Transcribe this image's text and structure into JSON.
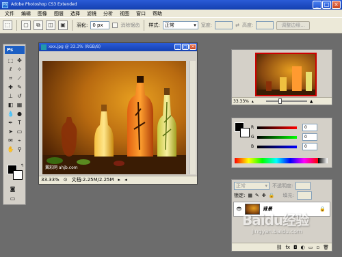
{
  "app": {
    "title": "Adobe Photoshop CS3 Extended"
  },
  "menubar": {
    "items": [
      "文件",
      "编辑",
      "图像",
      "图层",
      "选择",
      "滤镜",
      "分析",
      "视图",
      "窗口",
      "帮助"
    ]
  },
  "options": {
    "feather_label": "羽化:",
    "feather_value": "0 px",
    "antialias_label": "消除锯齿",
    "style_label": "样式:",
    "style_value": "正常",
    "width_label": "宽度:",
    "height_label": "高度:",
    "refine_button": "调整边缘..."
  },
  "toolbox": {
    "logo": "Ps"
  },
  "document": {
    "title": "xxx.jpg @ 33.3% (RGB/8)",
    "zoom": "33.33%",
    "doc_info": "文档:2.25M/2.25M",
    "watermark": "翼彩网 ahjb.com"
  },
  "navigator": {
    "zoom": "33.33%"
  },
  "color": {
    "r_label": "R",
    "g_label": "G",
    "b_label": "B",
    "r_value": "0",
    "g_value": "0",
    "b_value": "0"
  },
  "layers": {
    "blend_mode": "正常",
    "opacity_label": "不透明度:",
    "lock_label": "锁定:",
    "fill_label": "填充:",
    "layer_name": "背景"
  },
  "site_watermark": {
    "brand": "Baidu经验",
    "url": "jingyan.baidu.com"
  }
}
